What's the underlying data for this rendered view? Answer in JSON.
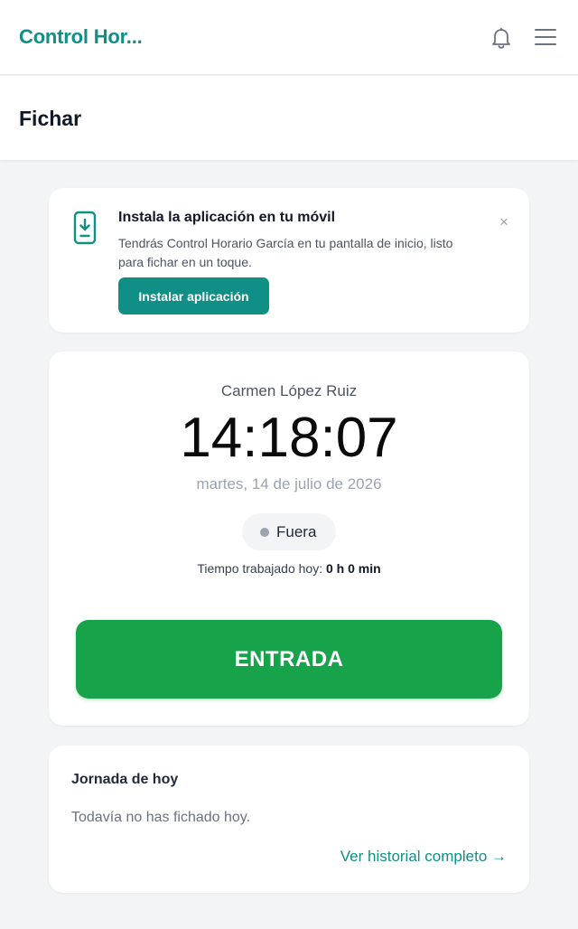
{
  "header": {
    "app_title": "Control Hor...",
    "notifications_icon": "bell-icon",
    "menu_icon": "hamburger-menu-icon"
  },
  "page": {
    "title": "Fichar"
  },
  "install_banner": {
    "icon": "phone-download-icon",
    "title": "Instala la aplicación en tu móvil",
    "description": "Tendrás Control Horario García en tu pantalla de inicio, listo para fichar en un toque.",
    "button_label": "Instalar aplicación",
    "close_label": "×"
  },
  "clock": {
    "employee_name": "Carmen López Ruiz",
    "time": "14:18:07",
    "date": "martes, 14 de julio de 2026",
    "status": "Fuera",
    "status_color": "#9ca3af",
    "worked_label": "Tiempo trabajado hoy:",
    "worked_value": "0 h 0 min",
    "action_label": "ENTRADA"
  },
  "today": {
    "title": "Jornada de hoy",
    "empty_message": "Todavía no has fichado hoy.",
    "history_link": "Ver historial completo →"
  },
  "colors": {
    "brand": "#0f8f86",
    "action_green": "#16a34a",
    "background": "#f3f4f6"
  }
}
